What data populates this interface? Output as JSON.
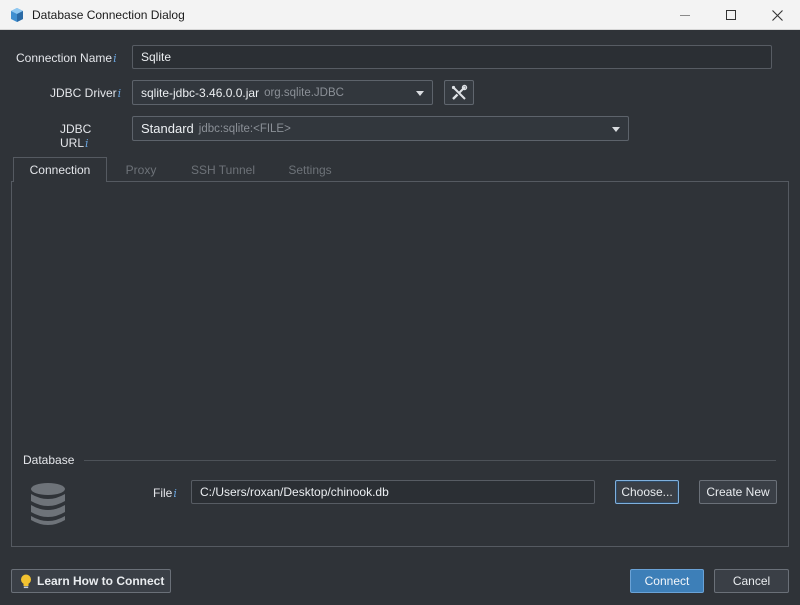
{
  "window": {
    "title": "Database Connection Dialog",
    "app_icon": "database-app-icon"
  },
  "form": {
    "connection_name_label": "Connection Name",
    "connection_name_value": "Sqlite",
    "jdbc_driver_label": "JDBC Driver",
    "jdbc_driver_value": "sqlite-jdbc-3.46.0.0.jar",
    "jdbc_driver_class": "org.sqlite.JDBC",
    "jdbc_url_label": "JDBC URL",
    "jdbc_url_value": "Standard",
    "jdbc_url_template": "jdbc:sqlite:<FILE>",
    "info_glyph": "i"
  },
  "tabs": [
    {
      "label": "Connection",
      "active": true
    },
    {
      "label": "Proxy",
      "active": false
    },
    {
      "label": "SSH Tunnel",
      "active": false
    },
    {
      "label": "Settings",
      "active": false
    }
  ],
  "database": {
    "group_title": "Database",
    "file_label": "File",
    "file_value": "C:/Users/roxan/Desktop/chinook.db",
    "choose_label": "Choose...",
    "create_new_label": "Create New"
  },
  "footer": {
    "learn_label": "Learn How to Connect",
    "connect_label": "Connect",
    "cancel_label": "Cancel"
  },
  "colors": {
    "background": "#2f3338",
    "accent": "#3d7fb8",
    "info": "#6aa6e0",
    "lightbulb": "#f2c230"
  }
}
